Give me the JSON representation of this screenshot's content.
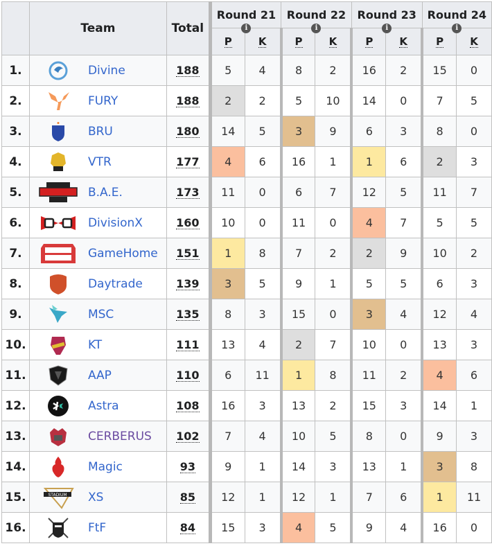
{
  "header": {
    "rank_label": "",
    "team_label": "Team",
    "total_label": "Total",
    "rounds": [
      {
        "label": "Round 21",
        "info_icon": "info-icon",
        "p_label": "P",
        "k_label": "K"
      },
      {
        "label": "Round 22",
        "info_icon": "info-icon",
        "p_label": "P",
        "k_label": "K"
      },
      {
        "label": "Round 23",
        "info_icon": "info-icon",
        "p_label": "P",
        "k_label": "K"
      },
      {
        "label": "Round 24",
        "info_icon": "info-icon",
        "p_label": "P",
        "k_label": "K"
      }
    ]
  },
  "highlight_colors": {
    "gold": "#fde9a0",
    "silver": "#dedede",
    "bronze": "#e2bf8f",
    "fourth": "#fbbf9e",
    "link": "#3366cc",
    "visited_link": "#6b4ba1"
  },
  "rows": [
    {
      "rank": "1.",
      "team": "Divine",
      "logo": "divine-logo",
      "total": "188",
      "rounds": [
        [
          5,
          4
        ],
        [
          8,
          2
        ],
        [
          16,
          2
        ],
        [
          15,
          0
        ]
      ]
    },
    {
      "rank": "2.",
      "team": "FURY",
      "logo": "fury-logo",
      "total": "188",
      "rounds": [
        [
          2,
          2
        ],
        [
          5,
          10
        ],
        [
          14,
          0
        ],
        [
          7,
          5
        ]
      ]
    },
    {
      "rank": "3.",
      "team": "BRU",
      "logo": "bru-logo",
      "total": "180",
      "rounds": [
        [
          14,
          5
        ],
        [
          3,
          9
        ],
        [
          6,
          3
        ],
        [
          8,
          0
        ]
      ]
    },
    {
      "rank": "4.",
      "team": "VTR",
      "logo": "vtr-logo",
      "total": "177",
      "rounds": [
        [
          4,
          6
        ],
        [
          16,
          1
        ],
        [
          1,
          6
        ],
        [
          2,
          3
        ]
      ]
    },
    {
      "rank": "5.",
      "team": "B.A.E.",
      "logo": "battle-arena-elites-logo",
      "total": "173",
      "rounds": [
        [
          11,
          0
        ],
        [
          6,
          7
        ],
        [
          12,
          5
        ],
        [
          11,
          7
        ]
      ]
    },
    {
      "rank": "6.",
      "team": "DivisionX",
      "logo": "divisionx-logo",
      "total": "160",
      "rounds": [
        [
          10,
          0
        ],
        [
          11,
          0
        ],
        [
          4,
          7
        ],
        [
          5,
          5
        ]
      ]
    },
    {
      "rank": "7.",
      "team": "GameHome",
      "logo": "gamehome-logo",
      "total": "151",
      "rounds": [
        [
          1,
          8
        ],
        [
          7,
          2
        ],
        [
          2,
          9
        ],
        [
          10,
          2
        ]
      ]
    },
    {
      "rank": "8.",
      "team": "Daytrade",
      "logo": "daytrade-logo",
      "total": "139",
      "rounds": [
        [
          3,
          5
        ],
        [
          9,
          1
        ],
        [
          5,
          5
        ],
        [
          6,
          3
        ]
      ]
    },
    {
      "rank": "9.",
      "team": "MSC",
      "logo": "msc-logo",
      "total": "135",
      "rounds": [
        [
          8,
          3
        ],
        [
          15,
          0
        ],
        [
          3,
          4
        ],
        [
          12,
          4
        ]
      ]
    },
    {
      "rank": "10.",
      "team": "KT",
      "logo": "kt-logo",
      "total": "111",
      "rounds": [
        [
          13,
          4
        ],
        [
          2,
          7
        ],
        [
          10,
          0
        ],
        [
          13,
          3
        ]
      ]
    },
    {
      "rank": "11.",
      "team": "AAP",
      "logo": "aap-logo",
      "total": "110",
      "rounds": [
        [
          6,
          11
        ],
        [
          1,
          8
        ],
        [
          11,
          2
        ],
        [
          4,
          6
        ]
      ]
    },
    {
      "rank": "12.",
      "team": "Astra",
      "logo": "astra-logo",
      "total": "108",
      "rounds": [
        [
          16,
          3
        ],
        [
          13,
          2
        ],
        [
          15,
          3
        ],
        [
          14,
          1
        ]
      ]
    },
    {
      "rank": "13.",
      "team": "CERBERUS",
      "logo": "cerberus-logo",
      "total": "102",
      "visited": true,
      "rounds": [
        [
          7,
          4
        ],
        [
          10,
          5
        ],
        [
          8,
          0
        ],
        [
          9,
          3
        ]
      ]
    },
    {
      "rank": "14.",
      "team": "Magic",
      "logo": "magic-logo",
      "total": "93",
      "rounds": [
        [
          9,
          1
        ],
        [
          14,
          3
        ],
        [
          13,
          1
        ],
        [
          3,
          8
        ]
      ]
    },
    {
      "rank": "15.",
      "team": "XS",
      "logo": "xs-stadium-logo",
      "total": "85",
      "rounds": [
        [
          12,
          1
        ],
        [
          12,
          1
        ],
        [
          7,
          6
        ],
        [
          1,
          11
        ]
      ]
    },
    {
      "rank": "16.",
      "team": "FtF",
      "logo": "ftf-logo",
      "total": "84",
      "rounds": [
        [
          15,
          3
        ],
        [
          4,
          5
        ],
        [
          9,
          4
        ],
        [
          16,
          0
        ]
      ]
    }
  ]
}
